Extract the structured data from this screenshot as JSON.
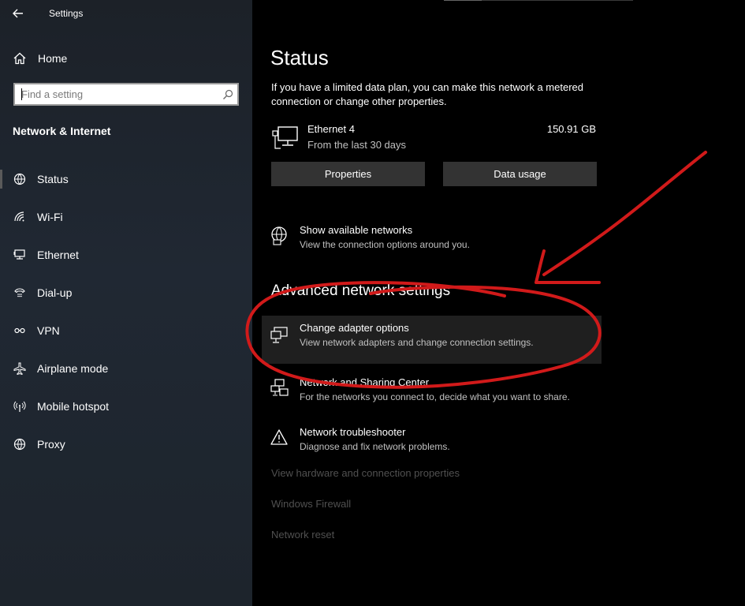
{
  "window": {
    "title": "Settings"
  },
  "sidebar": {
    "home_label": "Home",
    "search": {
      "placeholder": "Find a setting",
      "value": ""
    },
    "section_title": "Network & Internet",
    "items": [
      {
        "label": "Status",
        "icon": "status-icon",
        "active": true
      },
      {
        "label": "Wi-Fi",
        "icon": "wifi-icon"
      },
      {
        "label": "Ethernet",
        "icon": "ethernet-icon"
      },
      {
        "label": "Dial-up",
        "icon": "dialup-icon"
      },
      {
        "label": "VPN",
        "icon": "vpn-icon"
      },
      {
        "label": "Airplane mode",
        "icon": "airplane-icon"
      },
      {
        "label": "Mobile hotspot",
        "icon": "hotspot-icon"
      },
      {
        "label": "Proxy",
        "icon": "globe-icon"
      }
    ]
  },
  "main": {
    "title": "Status",
    "intro": "If you have a limited data plan, you can make this network a metered connection or change other properties.",
    "adapter": {
      "name": "Ethernet 4",
      "period": "From the last 30 days",
      "usage": "150.91 GB"
    },
    "buttons": {
      "properties": "Properties",
      "data_usage": "Data usage"
    },
    "show_networks": {
      "title": "Show available networks",
      "desc": "View the connection options around you."
    },
    "advanced_heading": "Advanced network settings",
    "change_adapter": {
      "title": "Change adapter options",
      "desc": "View network adapters and change connection settings."
    },
    "sharing_center": {
      "title": "Network and Sharing Center",
      "desc": "For the networks you connect to, decide what you want to share."
    },
    "troubleshooter": {
      "title": "Network troubleshooter",
      "desc": "Diagnose and fix network problems."
    },
    "links": [
      "View hardware and connection properties",
      "Windows Firewall",
      "Network reset"
    ]
  },
  "colors": {
    "sidebar_bg": "#202833",
    "annotation": "#d11a1a",
    "button_bg": "#333333"
  }
}
